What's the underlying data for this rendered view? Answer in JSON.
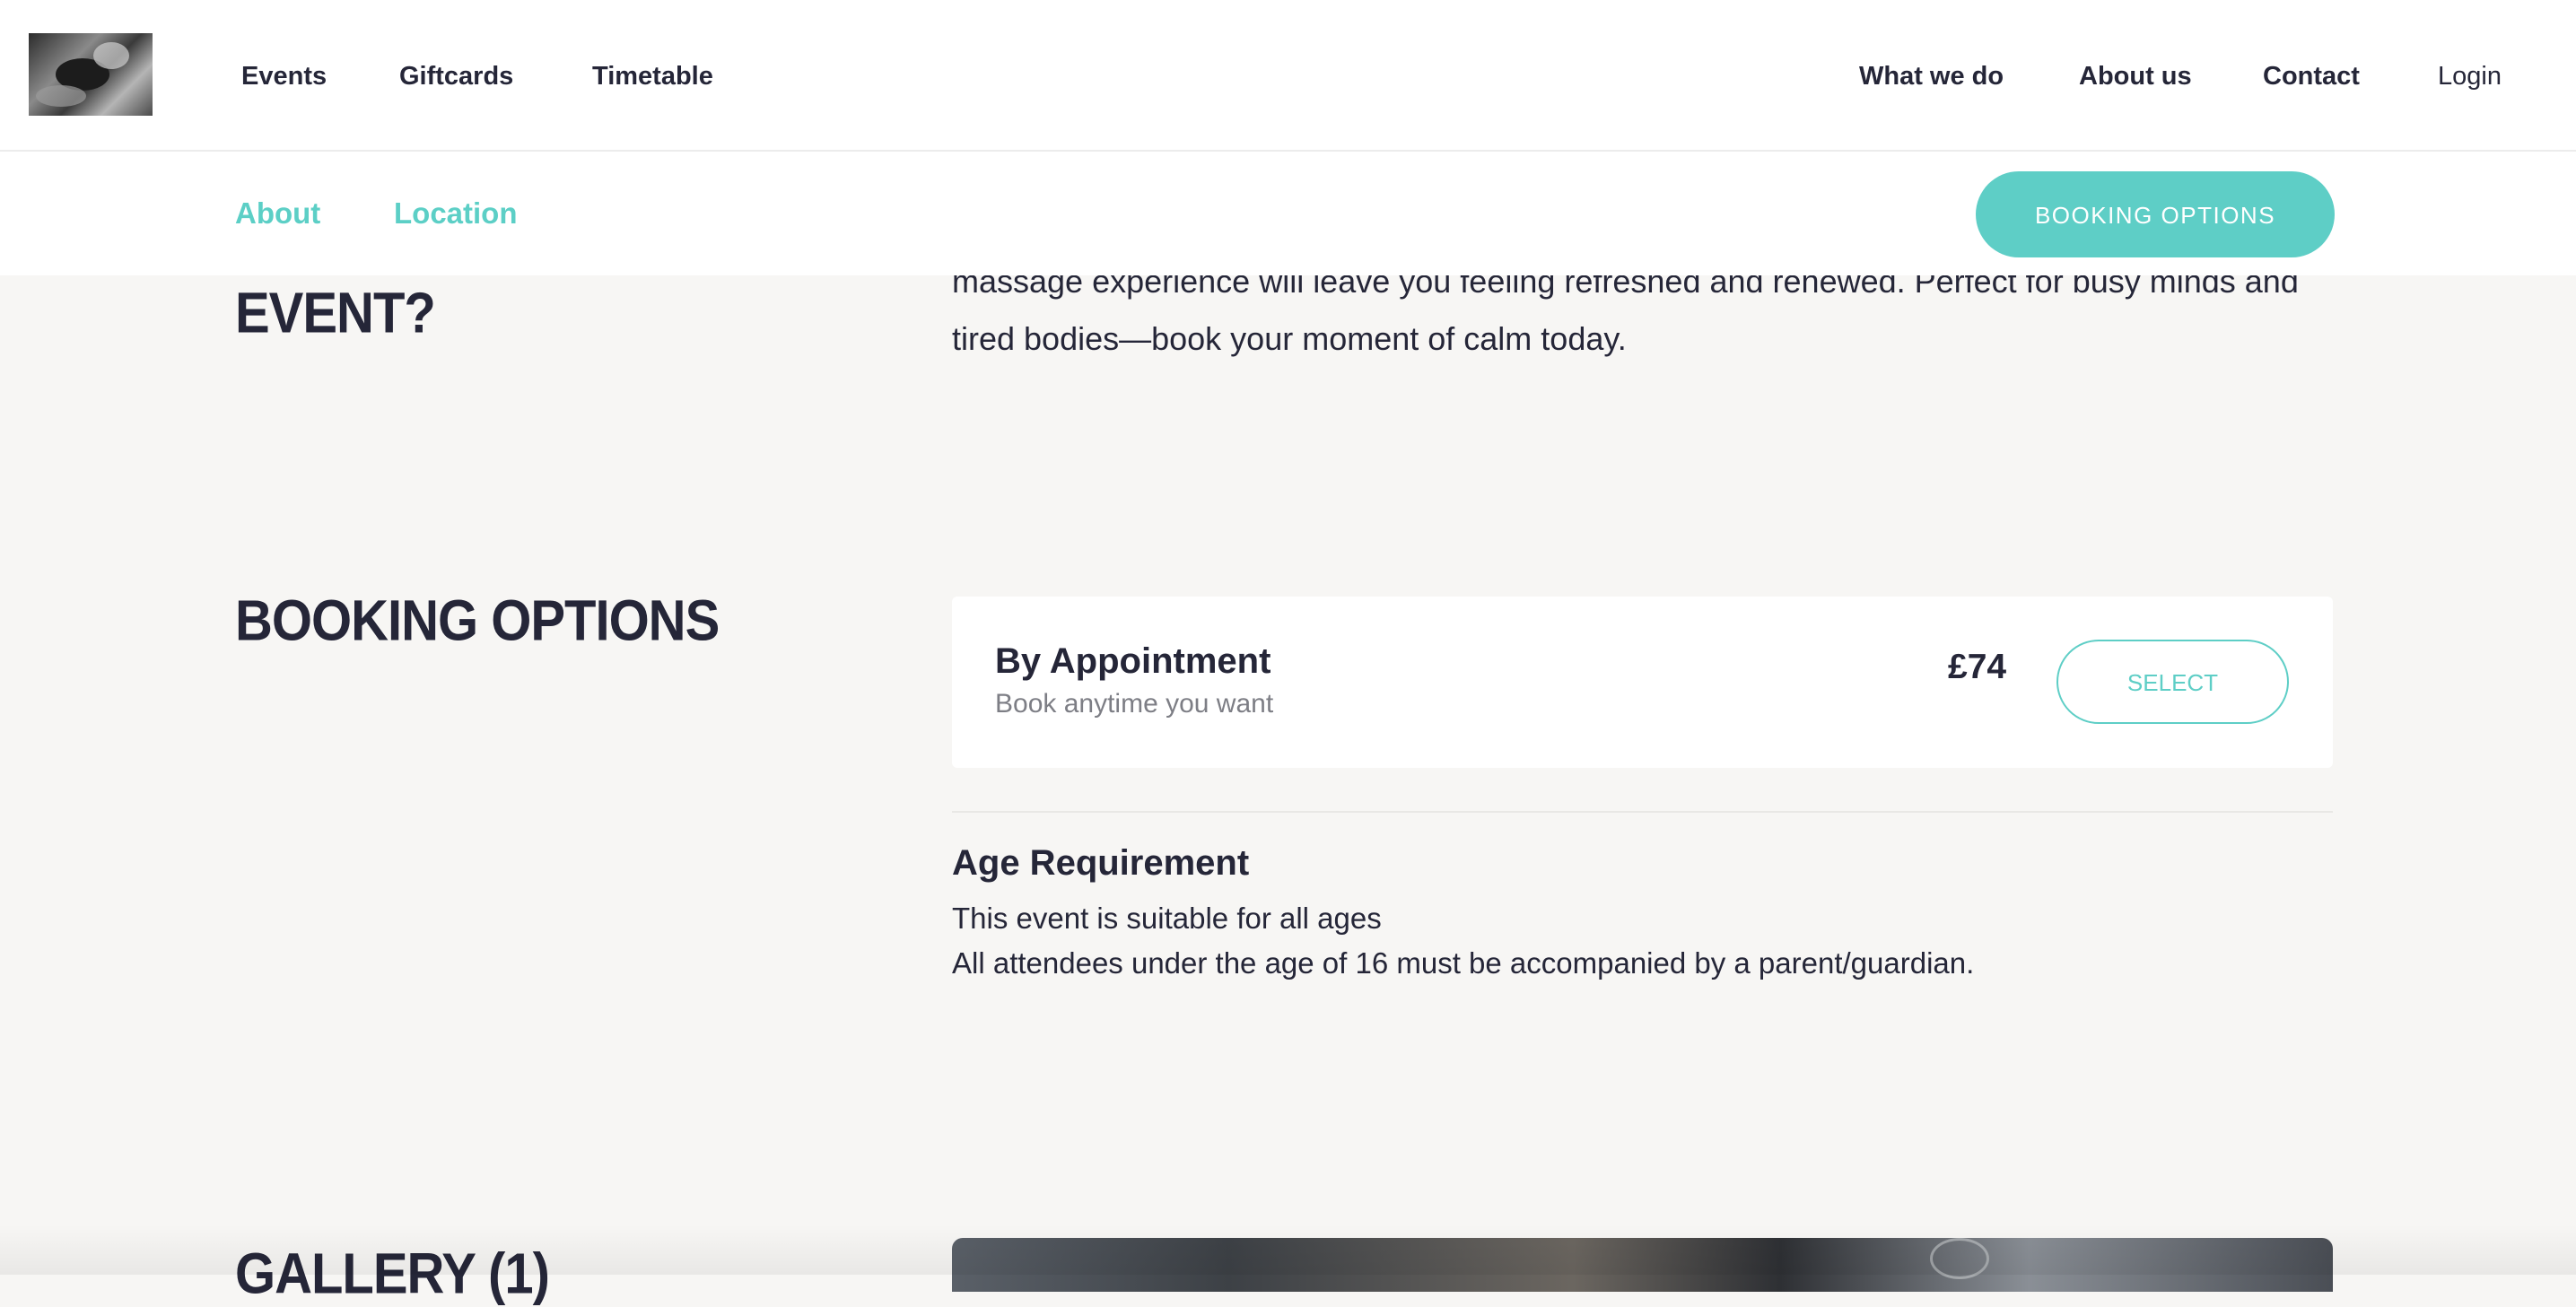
{
  "nav": {
    "left_links": [
      "Events",
      "Giftcards",
      "Timetable"
    ],
    "right_links": [
      "What we do",
      "About us",
      "Contact"
    ],
    "login": "Login"
  },
  "subnav": {
    "links": [
      "About",
      "Location"
    ],
    "booking_button": "BOOKING OPTIONS"
  },
  "intro": {
    "heading_tail": "EVENT?",
    "text_line1": "massage experience will leave you feeling refreshed and renewed. Perfect for busy minds and",
    "text_line2": "tired bodies—book your moment of calm today."
  },
  "booking": {
    "heading": "BOOKING OPTIONS",
    "option": {
      "title": "By Appointment",
      "subtitle": "Book anytime you want",
      "price": "£74",
      "select_label": "SELECT"
    },
    "age": {
      "title": "Age Requirement",
      "line1": "This event is suitable for all ages",
      "line2": "All attendees under the age of 16 must be accompanied by a parent/guardian."
    }
  },
  "gallery": {
    "heading": "GALLERY (1)"
  },
  "colors": {
    "accent": "#5ecec6",
    "text": "#252638",
    "muted": "#7d7e85",
    "page_bg": "#f7f6f4"
  }
}
